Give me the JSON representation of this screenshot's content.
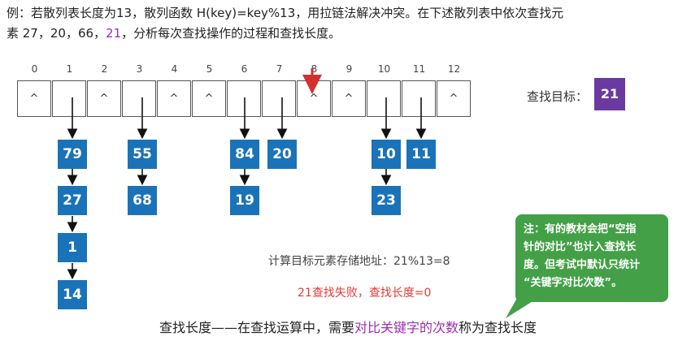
{
  "problem": {
    "line1": "例：若散列表长度为13，散列函数 H(key)=key%13，用拉链法解决冲突。在下述散列表中依次查找元",
    "line2_pre": "素 27，20，66，",
    "line2_hl": "21",
    "line2_post": "，分析每次查找操作的过程和查找长度。"
  },
  "table": {
    "indices": [
      "0",
      "1",
      "2",
      "3",
      "4",
      "5",
      "6",
      "7",
      "8",
      "9",
      "10",
      "11",
      "12"
    ],
    "cells": [
      "^",
      "",
      "^",
      "",
      "^",
      "^",
      "",
      "",
      "^",
      "^",
      "",
      "",
      "^"
    ]
  },
  "chains": {
    "bucket1": [
      "79",
      "27",
      "1",
      "14"
    ],
    "bucket3": [
      "55",
      "68"
    ],
    "bucket6": [
      "84",
      "19"
    ],
    "bucket7": [
      "20"
    ],
    "bucket10": [
      "10",
      "23"
    ],
    "bucket11": [
      "11"
    ]
  },
  "target": {
    "label": "查找目标：",
    "value": "21"
  },
  "calc_text": "计算目标元素存储地址：21%13=8",
  "fail_text": "21查找失败，查找长度=0",
  "definition": {
    "pre": "查找长度——在查找运算中，需要",
    "emph": "对比关键字的次数",
    "post": "称为查找长度"
  },
  "note": {
    "line1": "注：有的教材会把“空指",
    "line2": "针的对比”也计入查找长",
    "line3": "度。但考试中默认只统计",
    "line4": "“关键字对比次数”。"
  },
  "colors": {
    "node": "#1a73b8",
    "target": "#6b3aa0",
    "note": "#43a047",
    "fail": "#e53935",
    "highlight": "#9b2fae"
  }
}
